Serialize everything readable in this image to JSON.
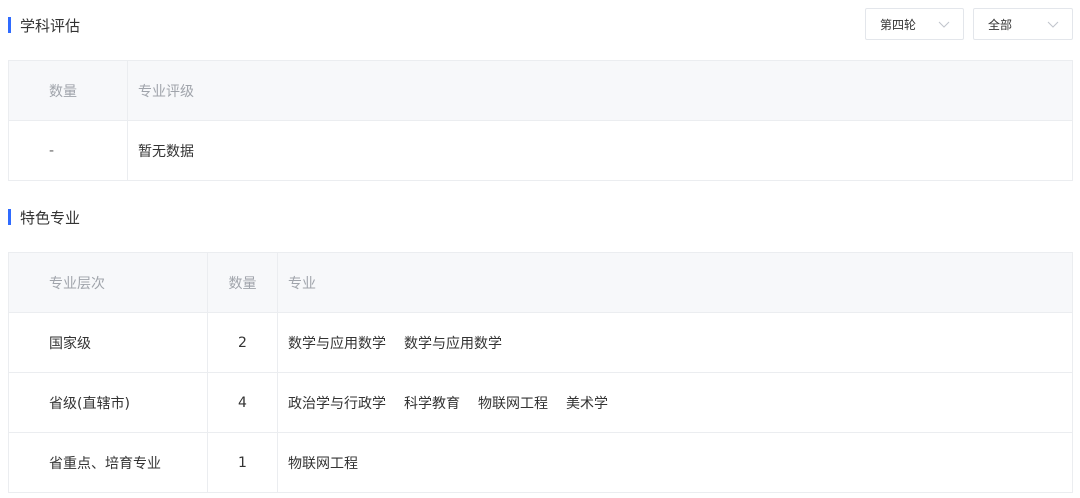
{
  "section1": {
    "title": "学科评估",
    "round_select": "第四轮",
    "scope_select": "全部",
    "headers": [
      "数量",
      "专业评级"
    ],
    "row": {
      "count": "-",
      "rating": "暂无数据"
    }
  },
  "section2": {
    "title": "特色专业",
    "headers": [
      "专业层次",
      "数量",
      "专业"
    ],
    "rows": [
      {
        "level": "国家级",
        "count": "2",
        "majors": [
          "数学与应用数学",
          "数学与应用数学"
        ]
      },
      {
        "level": "省级(直辖市)",
        "count": "4",
        "majors": [
          "政治学与行政学",
          "科学教育",
          "物联网工程",
          "美术学"
        ]
      },
      {
        "level": "省重点、培育专业",
        "count": "1",
        "majors": [
          "物联网工程"
        ]
      }
    ]
  },
  "colors": {
    "accent": "#2f6bff",
    "header_bg": "#f7f8fa",
    "border": "#ebedf0"
  },
  "icons": [
    "chevron-down-icon"
  ]
}
